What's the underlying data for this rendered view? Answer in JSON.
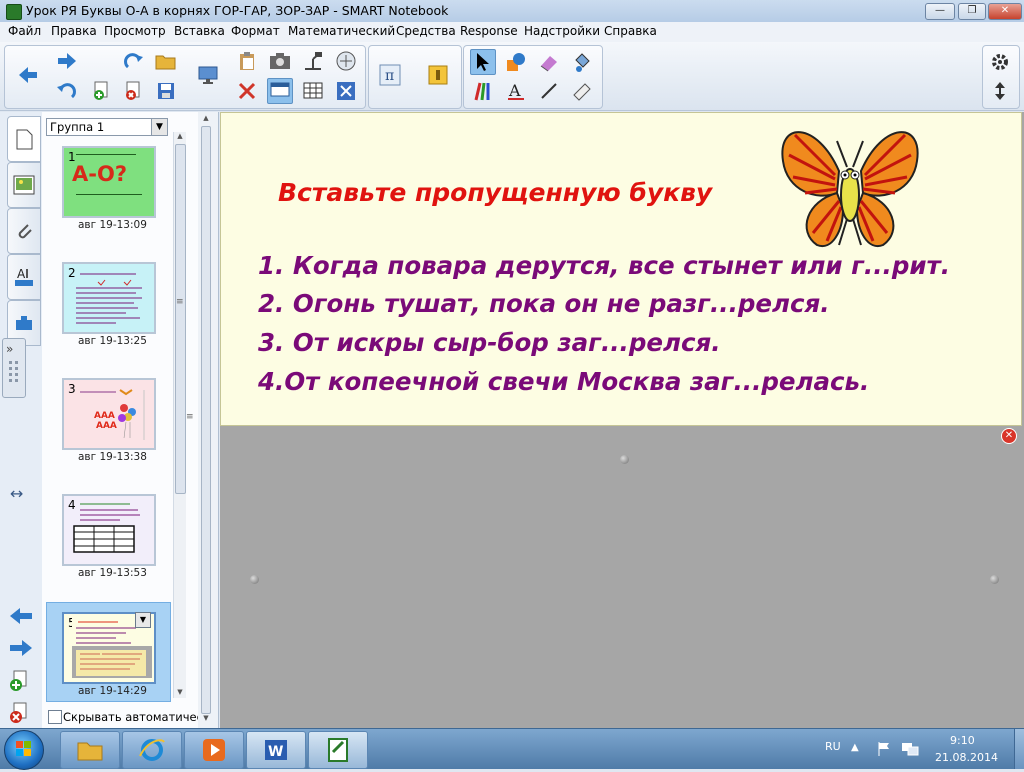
{
  "window": {
    "title": "Урок РЯ Буквы О-А в корнях ГОР-ГАР, ЗОР-ЗАР - SMART Notebook"
  },
  "menu": [
    "Файл",
    "Правка",
    "Просмотр",
    "Вставка",
    "Формат",
    "Математический",
    "Средства",
    "Response",
    "Надстройки",
    "Справка"
  ],
  "sorter": {
    "group": "Группа 1",
    "pages": [
      {
        "num": "1",
        "time": "авг 19-13:09"
      },
      {
        "num": "2",
        "time": "авг 19-13:25"
      },
      {
        "num": "3",
        "time": "авг 19-13:38"
      },
      {
        "num": "4",
        "time": "авг 19-13:53"
      },
      {
        "num": "5",
        "time": "авг 19-14:29"
      }
    ],
    "thumb1_text": "А-О?",
    "hide_label": "Скрывать автоматически"
  },
  "slide": {
    "title": "Вставьте пропущенную букву",
    "lines": [
      "1. Когда повара дерутся, все стынет или г...рит.",
      "2. Огонь тушат, пока он не разг...релся.",
      "3. От искры сыр-бор заг...релся.",
      "4.От копеечной свечи Москва заг...релась."
    ]
  },
  "taskbar": {
    "lang": "RU",
    "time": "9:10",
    "date": "21.08.2014"
  },
  "colors": {
    "slide_bg": "#fdfde3",
    "title_red": "#e0130f",
    "text_purple": "#7a0a78",
    "canvas_gray": "#a6a6a6"
  }
}
